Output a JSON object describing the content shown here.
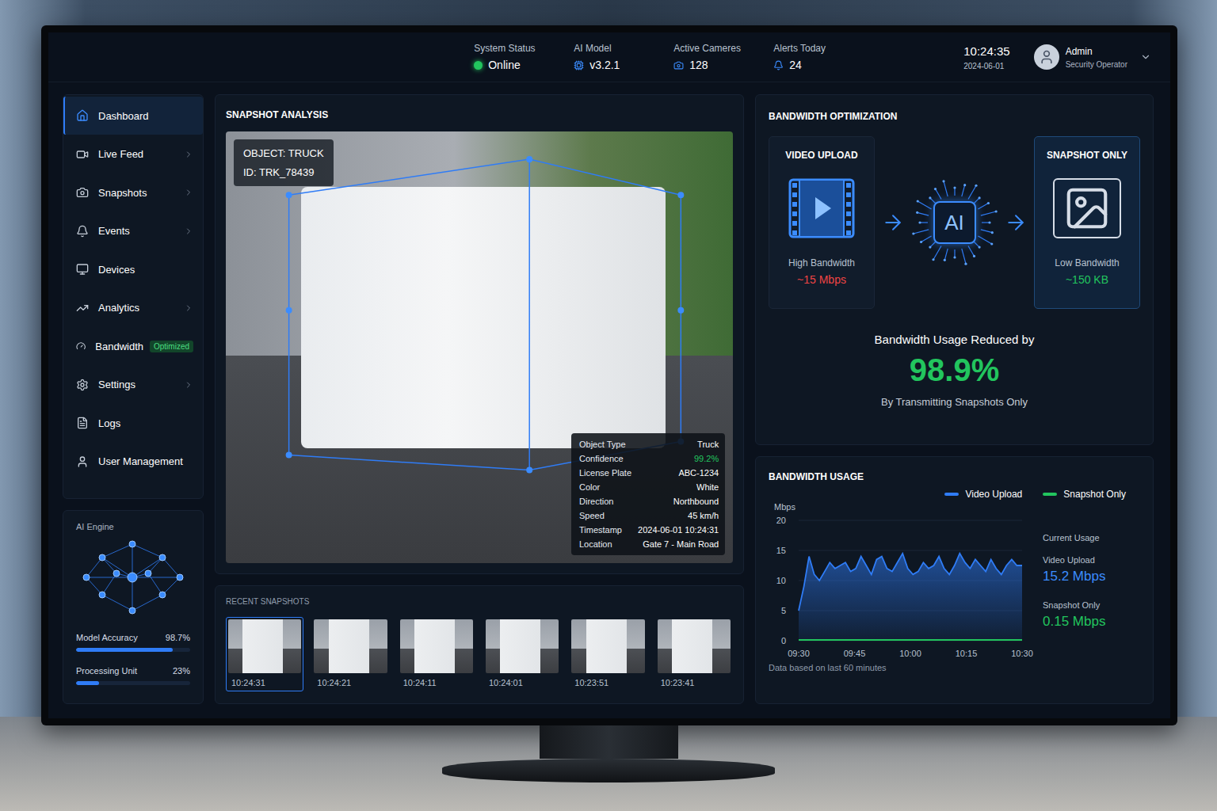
{
  "header": {
    "stats": [
      {
        "label": "System Status",
        "value": "Online",
        "kind": "status"
      },
      {
        "label": "AI Model",
        "value": "v3.2.1",
        "kind": "value"
      },
      {
        "label": "Active Cameres",
        "value": "128",
        "kind": "value"
      },
      {
        "label": "Alerts Today",
        "value": "24",
        "kind": "value"
      }
    ],
    "time": "10:24:35",
    "date": "2024-06-01",
    "user": {
      "name": "Admin",
      "role": "Security Operator"
    }
  },
  "sidebar": {
    "items": [
      {
        "label": "Dashboard",
        "selected": true,
        "expandable": false
      },
      {
        "label": "Live Feed",
        "selected": false,
        "expandable": true
      },
      {
        "label": "Snapshots",
        "selected": false,
        "expandable": true
      },
      {
        "label": "Events",
        "selected": false,
        "expandable": true
      },
      {
        "label": "Devices",
        "selected": false,
        "expandable": false
      },
      {
        "label": "Analytics",
        "selected": false,
        "expandable": true
      },
      {
        "label": "Bandwidth",
        "selected": false,
        "expandable": false,
        "badge": "Optimized"
      },
      {
        "label": "Settings",
        "selected": false,
        "expandable": true
      },
      {
        "label": "Logs",
        "selected": false,
        "expandable": false
      },
      {
        "label": "User Management",
        "selected": false,
        "expandable": false
      }
    ]
  },
  "ai_engine": {
    "title": "AI Engine",
    "meters": [
      {
        "label": "Model Accuracy",
        "reading": "98.7%",
        "level": 0.85
      },
      {
        "label": "Processing Unit",
        "reading": "23%",
        "level": 0.2
      }
    ]
  },
  "snapshot": {
    "title": "SNAPSHOT ANALYSIS",
    "object_label": "OBJECT: TRUCK",
    "object_id": "ID: TRK_78439",
    "details": [
      {
        "label": "Object Type",
        "value": "Truck",
        "highlight": false
      },
      {
        "label": "Confidence",
        "value": "99.2%",
        "highlight": true
      },
      {
        "label": "License Plate",
        "value": "ABC-1234",
        "highlight": false
      },
      {
        "label": "Color",
        "value": "White",
        "highlight": false
      },
      {
        "label": "Direction",
        "value": "Northbound",
        "highlight": false
      },
      {
        "label": "Speed",
        "value": "45 km/h",
        "highlight": false
      },
      {
        "label": "Timestamp",
        "value": "2024-06-01 10:24:31",
        "highlight": false
      },
      {
        "label": "Location",
        "value": "Gate 7 - Main Road",
        "highlight": false
      }
    ]
  },
  "recent": {
    "title": "RECENT SNAPSHOTS",
    "items": [
      {
        "time": "10:24:31",
        "selected": true
      },
      {
        "time": "10:24:21",
        "selected": false
      },
      {
        "time": "10:24:11",
        "selected": false
      },
      {
        "time": "10:24:01",
        "selected": false
      },
      {
        "time": "10:23:51",
        "selected": false
      },
      {
        "time": "10:23:41",
        "selected": false
      }
    ]
  },
  "optimization": {
    "title": "BANDWIDTH OPTIMIZATION",
    "source": {
      "title": "VIDEO UPLOAD",
      "caption": "High Bandwidth",
      "value": "~15 Mbps"
    },
    "engine": "AI",
    "target": {
      "title": "SNAPSHOT ONLY",
      "caption": "Low Bandwidth",
      "value": "~150 KB"
    },
    "headline": "Bandwidth Usage Reduced by",
    "figure": "98.9%",
    "note": "By Transmitting Snapshots Only"
  },
  "usage": {
    "title": "BANDWIDTH USAGE",
    "unit": "Mbps",
    "y_ticks": [
      "20",
      "15",
      "10",
      "5",
      "0"
    ],
    "x_ticks": [
      "09:30",
      "09:45",
      "10:00",
      "10:15",
      "10:30"
    ],
    "series": [
      {
        "name": "Video Upload",
        "color": "#2f7cf6",
        "values": [
          5,
          9,
          14,
          11,
          10,
          11.5,
          13,
          12,
          12.5,
          13,
          11.5,
          12,
          14,
          12.5,
          11,
          13.5,
          14,
          12,
          11.5,
          13,
          14.5,
          12,
          11,
          11.5,
          13,
          12,
          12.5,
          14,
          12,
          11,
          12.5,
          14.5,
          13,
          12,
          13.5,
          12.5,
          11.5,
          13.5,
          12,
          11,
          12.5,
          13.5,
          12.5,
          12.5
        ]
      },
      {
        "name": "Snapshot Only",
        "color": "#22c55e",
        "values": [
          0.15,
          0.15,
          0.15,
          0.15,
          0.15,
          0.15,
          0.15,
          0.15,
          0.15,
          0.15,
          0.15,
          0.15,
          0.15,
          0.15,
          0.15,
          0.15,
          0.15,
          0.15,
          0.15,
          0.15,
          0.15,
          0.15,
          0.15,
          0.15,
          0.15,
          0.15,
          0.15,
          0.15,
          0.15,
          0.15,
          0.15,
          0.15,
          0.15,
          0.15,
          0.15,
          0.15,
          0.15,
          0.15,
          0.15,
          0.15,
          0.15,
          0.15,
          0.15,
          0.15
        ]
      }
    ],
    "current": {
      "title": "Current Usage",
      "items": [
        {
          "label": "Video Upload",
          "value": "15.2 Mbps",
          "color": "#3b8cff"
        },
        {
          "label": "Snapshot Only",
          "value": "0.15 Mbps",
          "color": "#22c55e"
        }
      ]
    },
    "footer": "Data based on last 60 minutes"
  }
}
